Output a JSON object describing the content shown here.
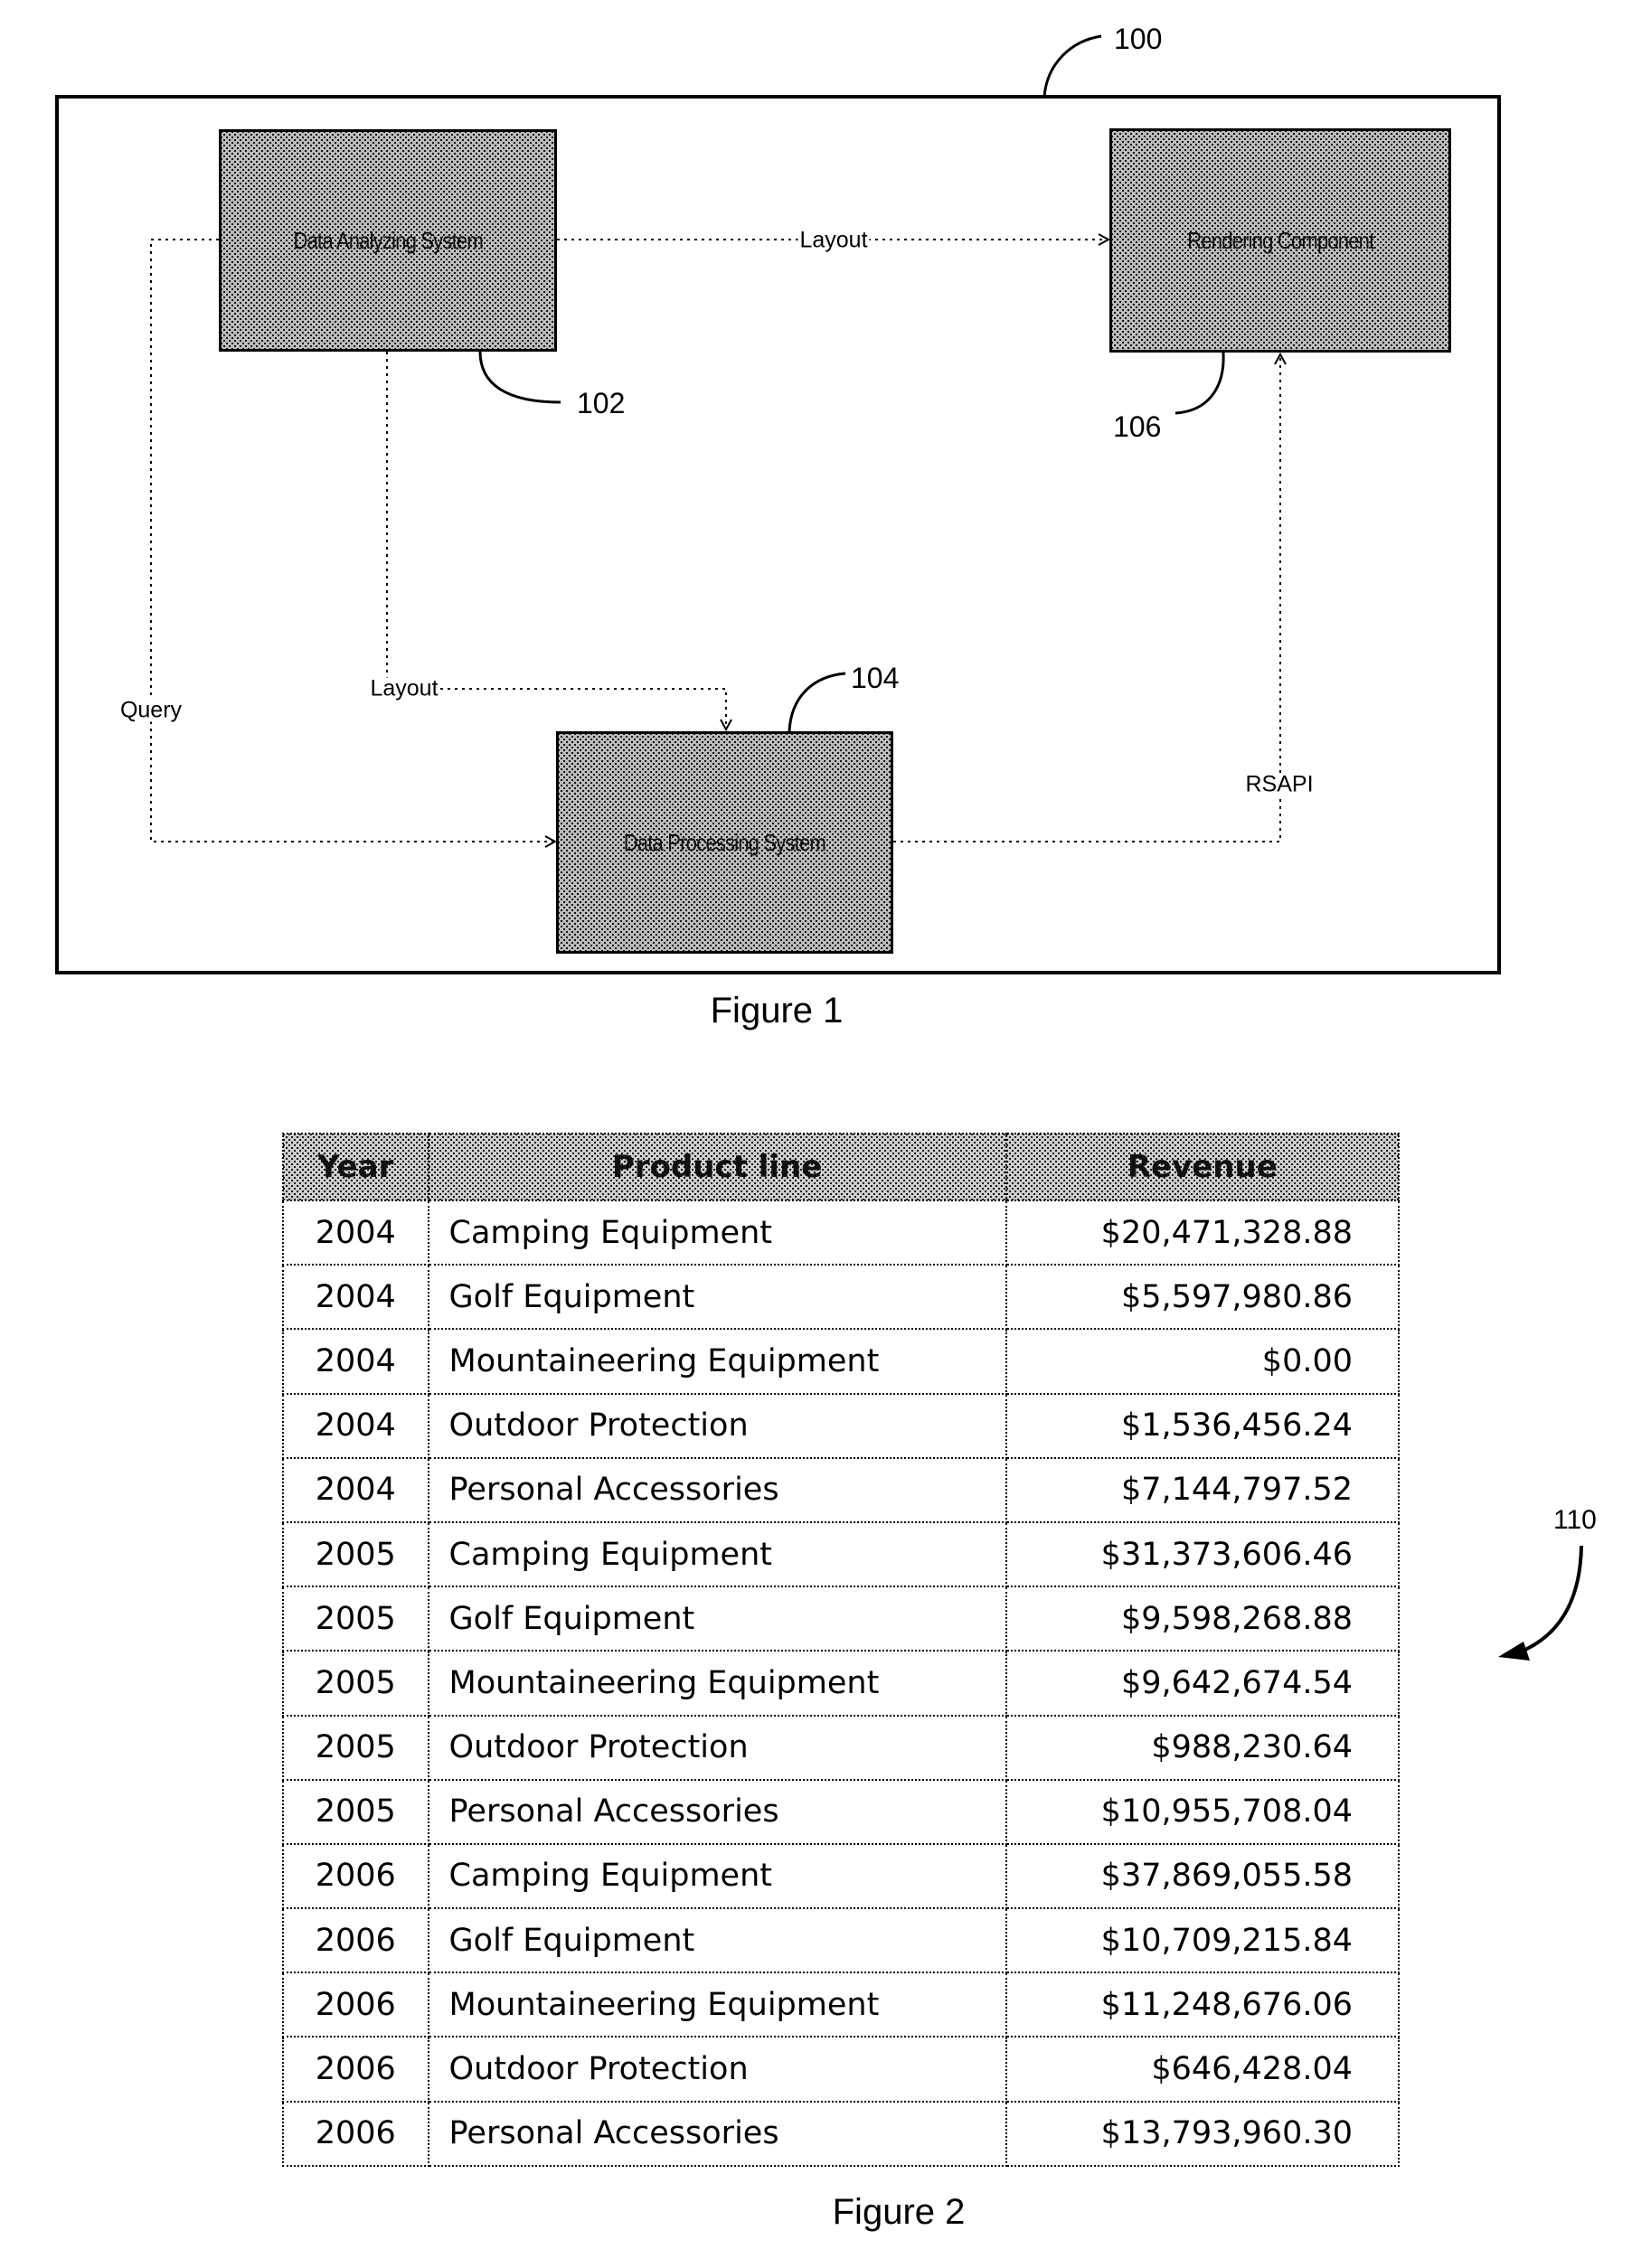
{
  "figure1": {
    "caption": "Figure 1",
    "container_ref": "100",
    "blocks": {
      "data_analyzing": {
        "label": "Data Analyzing System",
        "ref": "102"
      },
      "rendering": {
        "label": "Rendering Component",
        "ref": "106"
      },
      "data_processing": {
        "label": "Data Processing System",
        "ref": "104"
      }
    },
    "flows": {
      "layout_to_rendering": "Layout",
      "layout_to_processing": "Layout",
      "query": "Query",
      "rsapi": "RSAPI"
    }
  },
  "figure2": {
    "caption": "Figure 2",
    "ref": "110",
    "columns": [
      "Year",
      "Product line",
      "Revenue"
    ],
    "rows": [
      [
        "2004",
        "Camping Equipment",
        "$20,471,328.88"
      ],
      [
        "2004",
        "Golf Equipment",
        "$5,597,980.86"
      ],
      [
        "2004",
        "Mountaineering Equipment",
        "$0.00"
      ],
      [
        "2004",
        "Outdoor Protection",
        "$1,536,456.24"
      ],
      [
        "2004",
        "Personal Accessories",
        "$7,144,797.52"
      ],
      [
        "2005",
        "Camping Equipment",
        "$31,373,606.46"
      ],
      [
        "2005",
        "Golf Equipment",
        "$9,598,268.88"
      ],
      [
        "2005",
        "Mountaineering Equipment",
        "$9,642,674.54"
      ],
      [
        "2005",
        "Outdoor Protection",
        "$988,230.64"
      ],
      [
        "2005",
        "Personal Accessories",
        "$10,955,708.04"
      ],
      [
        "2006",
        "Camping Equipment",
        "$37,869,055.58"
      ],
      [
        "2006",
        "Golf Equipment",
        "$10,709,215.84"
      ],
      [
        "2006",
        "Mountaineering Equipment",
        "$11,248,676.06"
      ],
      [
        "2006",
        "Outdoor Protection",
        "$646,428.04"
      ],
      [
        "2006",
        "Personal Accessories",
        "$13,793,960.30"
      ]
    ]
  }
}
